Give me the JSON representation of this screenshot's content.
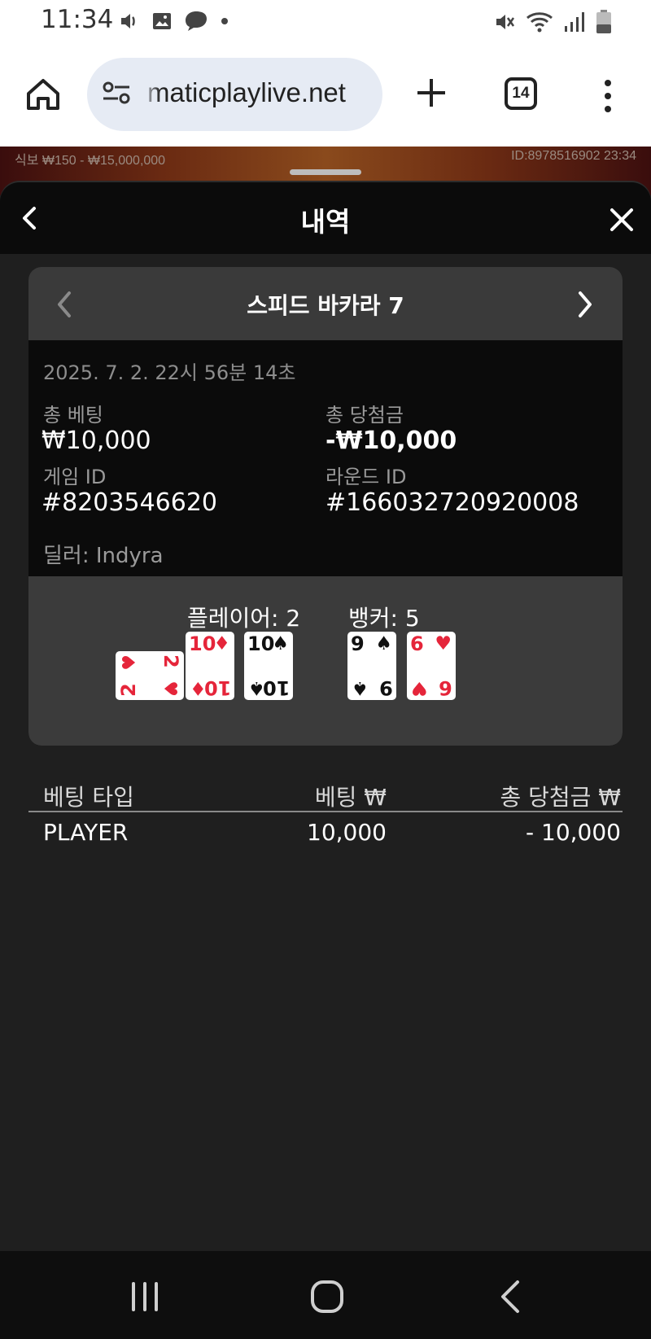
{
  "status_bar": {
    "time": "11:34",
    "left_icons": [
      "volume-icon",
      "image-icon",
      "chat-bubble-icon",
      "dot-icon"
    ],
    "right_icons": [
      "mute-icon",
      "wifi-icon",
      "signal-icon",
      "battery-icon"
    ]
  },
  "browser": {
    "url": "pragmaticplaylive.net",
    "visible_url": "maticplaylive.net",
    "tab_count": "14",
    "icons": [
      "home-icon",
      "site-settings-icon",
      "new-tab-icon",
      "tabs-icon",
      "more-icon"
    ]
  },
  "game_strip": {
    "limits": "식보 ₩150 - ₩15,000,000",
    "id_time": "ID:8978516902  23:34"
  },
  "panel": {
    "title": "내역"
  },
  "card": {
    "game_name": "스피드 바카라 7",
    "datetime": "2025. 7. 2. 22시 56분 14초",
    "total_bet_label": "총 베팅",
    "total_bet_value": "₩10,000",
    "total_win_label": "총 당첨금",
    "total_win_value": "-₩10,000",
    "game_id_label": "게임 ID",
    "game_id_value": "#8203546620",
    "round_id_label": "라운드 ID",
    "round_id_value": "#166032720920008",
    "dealer": "딜러: Indyra",
    "player_label": "플레이어: 2",
    "banker_label": "뱅커: 5",
    "player_cards": [
      {
        "rank": "2",
        "suit": "♥",
        "color": "red",
        "orientation": "sideways"
      },
      {
        "rank": "10",
        "suit": "♦",
        "color": "red"
      },
      {
        "rank": "10",
        "suit": "♠",
        "color": "black"
      }
    ],
    "banker_cards": [
      {
        "rank": "9",
        "suit": "♠",
        "color": "black"
      },
      {
        "rank": "6",
        "suit": "♥",
        "color": "red"
      }
    ]
  },
  "bets_table": {
    "headers": [
      "베팅 타입",
      "베팅 ₩",
      "총 당첨금 ₩"
    ],
    "rows": [
      {
        "type": "PLAYER",
        "bet": "10,000",
        "win": "- 10,000"
      }
    ]
  },
  "colors": {
    "panel_bg": "#1f1f1f",
    "header_bg": "#0b0b0b",
    "card_head_bg": "#3a3a3a",
    "red_suit": "#e5253a"
  }
}
